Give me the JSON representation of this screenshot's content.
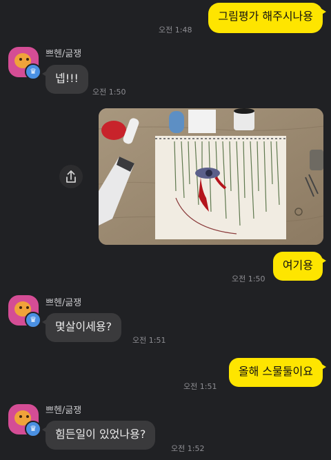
{
  "messages": [
    {
      "side": "me",
      "text": "그림평가 해주시나용",
      "time": "오전 1:48"
    },
    {
      "side": "them",
      "sender": "쁘헨/긂쟁",
      "text": "넵!!!",
      "time": "오전 1:50"
    },
    {
      "side": "me",
      "image": "drawing-photo",
      "time": ""
    },
    {
      "side": "me",
      "text": "여기용",
      "time": "오전 1:50"
    },
    {
      "side": "them",
      "sender": "쁘헨/긂쟁",
      "text": "몇살이세용?",
      "time": "오전 1:51"
    },
    {
      "side": "me",
      "text": "올해 스물둘이요",
      "time": "오전 1:51"
    },
    {
      "side": "them",
      "sender": "쁘헨/긂쟁",
      "text": "힘든일이 있었나용?",
      "time": "오전 1:52"
    }
  ],
  "icons": {
    "share": "share-icon",
    "avatar_badge": "crown-icon"
  },
  "colors": {
    "background": "#202124",
    "my_bubble": "#FEE500",
    "their_bubble": "#3a3a3c"
  }
}
